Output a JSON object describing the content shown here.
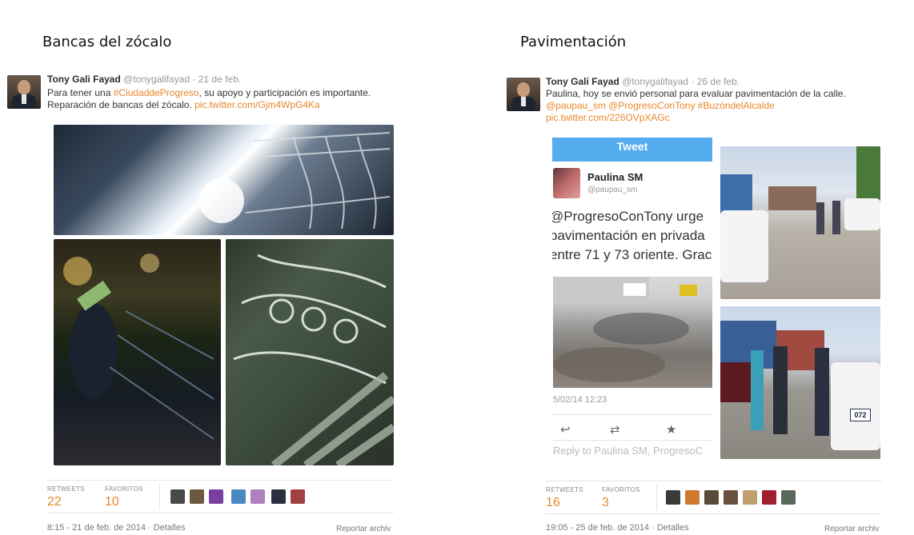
{
  "left": {
    "section_title": "Bancas del zócalo",
    "tweet": {
      "name": "Tony Gali Fayad",
      "handle": "@tonygalifayad",
      "date": "· 21 de feb.",
      "line1_pre": "Para tener una ",
      "line1_link": "#CiudaddeProgreso",
      "line1_post": ", su apoyo y participación es importante.",
      "line2_pre": "Reparación de bancas del zócalo. ",
      "line2_link": "pic.twitter.com/Gjm4WpG4Ka"
    },
    "stats": {
      "retweets_label": "RETWEETS",
      "retweets_value": "22",
      "favorites_label": "FAVORITOS",
      "favorites_value": "10"
    },
    "footer": {
      "timestamp": "8:15 - 21 de feb. de 2014 · Detalles",
      "report": "Reportar archiv"
    }
  },
  "right": {
    "section_title": "Pavimentación",
    "tweet": {
      "name": "Tony Gali Fayad",
      "handle": "@tonygalifayad",
      "date": "· 26 de feb.",
      "line1": "Paulina, hoy se envió personal para evaluar pavimentación de la calle.",
      "line2_link": "@paupau_sm @ProgresoConTony #BuzóndelAlcalde",
      "line3_link": "pic.twitter.com/226OVpXAGc"
    },
    "embedded": {
      "bar_title": "Tweet",
      "user_name": "Paulina SM",
      "user_handle": "@paupau_sm",
      "text1": "@ProgresoConTony urge",
      "text2": "pavimentación en privada",
      "text3": "entre 71 y 73 oriente. Grac",
      "timestamp": "5/02/14 12:23",
      "reply_placeholder": "Reply to Paulina SM, ProgresoC",
      "plate": "072"
    },
    "stats": {
      "retweets_label": "RETWEETS",
      "retweets_value": "16",
      "favorites_label": "FAVORITOS",
      "favorites_value": "3"
    },
    "footer": {
      "timestamp": "19:05 - 25 de feb. de 2014 · Detalles",
      "report": "Reportar archiv"
    }
  },
  "colors": {
    "link": "#e8872a",
    "twitter_blue": "#55acee"
  }
}
